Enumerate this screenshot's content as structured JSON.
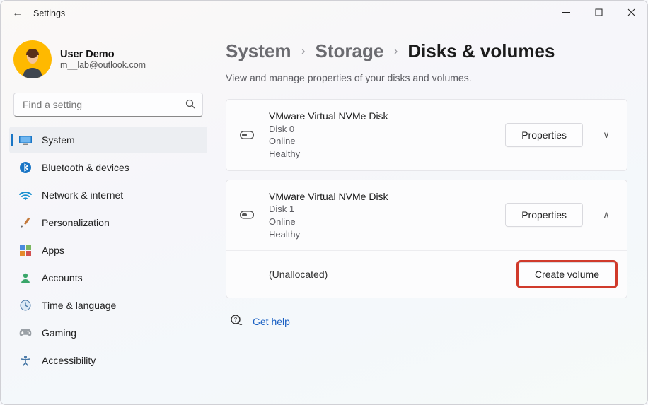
{
  "window": {
    "title": "Settings"
  },
  "user": {
    "name": "User Demo",
    "email": "m__lab@outlook.com"
  },
  "search": {
    "placeholder": "Find a setting"
  },
  "nav": [
    {
      "key": "system",
      "label": "System",
      "selected": true
    },
    {
      "key": "bluetooth",
      "label": "Bluetooth & devices",
      "selected": false
    },
    {
      "key": "network",
      "label": "Network & internet",
      "selected": false
    },
    {
      "key": "personalization",
      "label": "Personalization",
      "selected": false
    },
    {
      "key": "apps",
      "label": "Apps",
      "selected": false
    },
    {
      "key": "accounts",
      "label": "Accounts",
      "selected": false
    },
    {
      "key": "time",
      "label": "Time & language",
      "selected": false
    },
    {
      "key": "gaming",
      "label": "Gaming",
      "selected": false
    },
    {
      "key": "accessibility",
      "label": "Accessibility",
      "selected": false
    }
  ],
  "breadcrumb": {
    "a": "System",
    "b": "Storage",
    "c": "Disks & volumes"
  },
  "subtitle": "View and manage properties of your disks and volumes.",
  "disks": [
    {
      "title": "VMware Virtual NVMe Disk",
      "name": "Disk 0",
      "status": "Online",
      "health": "Healthy",
      "button": "Properties",
      "expanded": false
    },
    {
      "title": "VMware Virtual NVMe Disk",
      "name": "Disk 1",
      "status": "Online",
      "health": "Healthy",
      "button": "Properties",
      "expanded": true,
      "child": {
        "label": "(Unallocated)",
        "button": "Create volume"
      }
    }
  ],
  "help": {
    "label": "Get help"
  }
}
